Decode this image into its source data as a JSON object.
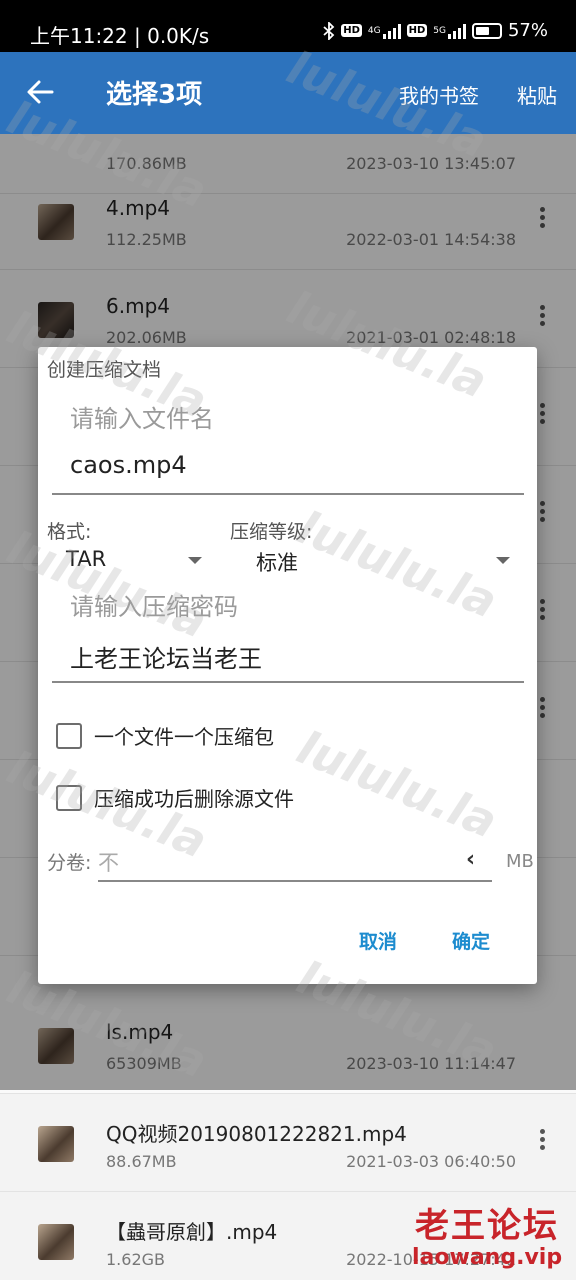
{
  "status_bar": {
    "time": "上午11:22 | 0.0K/s",
    "hd1": "HD",
    "net1": "4G",
    "hd2": "HD",
    "net2": "5G",
    "battery_text": "57%",
    "battery_level": 0.57
  },
  "app_bar": {
    "title": "选择3项",
    "action_bookmarks": "我的书签",
    "action_paste": "粘贴"
  },
  "files": [
    {
      "name": "",
      "size": "170.86MB",
      "date": "2023-03-10 13:45:07"
    },
    {
      "name": "4.mp4",
      "size": "112.25MB",
      "date": "2022-03-01 14:54:38"
    },
    {
      "name": "6.mp4",
      "size": "202.06MB",
      "date": "2021-03-01 02:48:18"
    },
    {
      "name": "ls.mp4",
      "size": "65309MB",
      "date": "2023-03-10 11:14:47"
    },
    {
      "name": "QQ视频20190801222821.mp4",
      "size": "88.67MB",
      "date": "2021-03-03 06:40:50"
    },
    {
      "name": "【蟲哥原創】.mp4",
      "size": "1.62GB",
      "date": "2022-10-15 17:27:41"
    }
  ],
  "dialog": {
    "title": "创建压缩文档",
    "filename_hint": "请输入文件名",
    "filename_value": "caos.mp4",
    "format_label": "格式:",
    "format_value": "TAR",
    "level_label": "压缩等级:",
    "level_value": "标准",
    "password_hint": "请输入压缩密码",
    "password_value": "上老王论坛当老王",
    "checkbox_one_per_file": "一个文件一个压缩包",
    "checkbox_delete_source": "压缩成功后删除源文件",
    "split_label": "分卷:",
    "split_value": "不",
    "split_unit": "MB",
    "cancel": "取消",
    "confirm": "确定"
  },
  "watermark": {
    "text": "lululu.la"
  },
  "corner_logo": {
    "name": "老王论坛",
    "url": "laowang.vip"
  }
}
